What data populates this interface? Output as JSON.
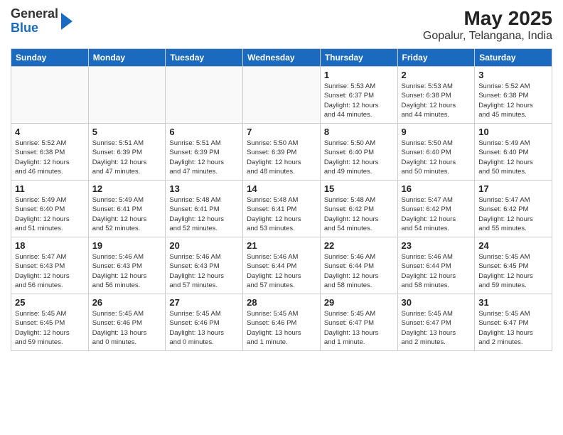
{
  "header": {
    "logo_general": "General",
    "logo_blue": "Blue",
    "title": "May 2025",
    "subtitle": "Gopalur, Telangana, India"
  },
  "days_of_week": [
    "Sunday",
    "Monday",
    "Tuesday",
    "Wednesday",
    "Thursday",
    "Friday",
    "Saturday"
  ],
  "weeks": [
    [
      {
        "day": "",
        "info": ""
      },
      {
        "day": "",
        "info": ""
      },
      {
        "day": "",
        "info": ""
      },
      {
        "day": "",
        "info": ""
      },
      {
        "day": "1",
        "info": "Sunrise: 5:53 AM\nSunset: 6:37 PM\nDaylight: 12 hours\nand 44 minutes."
      },
      {
        "day": "2",
        "info": "Sunrise: 5:53 AM\nSunset: 6:38 PM\nDaylight: 12 hours\nand 44 minutes."
      },
      {
        "day": "3",
        "info": "Sunrise: 5:52 AM\nSunset: 6:38 PM\nDaylight: 12 hours\nand 45 minutes."
      }
    ],
    [
      {
        "day": "4",
        "info": "Sunrise: 5:52 AM\nSunset: 6:38 PM\nDaylight: 12 hours\nand 46 minutes."
      },
      {
        "day": "5",
        "info": "Sunrise: 5:51 AM\nSunset: 6:39 PM\nDaylight: 12 hours\nand 47 minutes."
      },
      {
        "day": "6",
        "info": "Sunrise: 5:51 AM\nSunset: 6:39 PM\nDaylight: 12 hours\nand 47 minutes."
      },
      {
        "day": "7",
        "info": "Sunrise: 5:50 AM\nSunset: 6:39 PM\nDaylight: 12 hours\nand 48 minutes."
      },
      {
        "day": "8",
        "info": "Sunrise: 5:50 AM\nSunset: 6:40 PM\nDaylight: 12 hours\nand 49 minutes."
      },
      {
        "day": "9",
        "info": "Sunrise: 5:50 AM\nSunset: 6:40 PM\nDaylight: 12 hours\nand 50 minutes."
      },
      {
        "day": "10",
        "info": "Sunrise: 5:49 AM\nSunset: 6:40 PM\nDaylight: 12 hours\nand 50 minutes."
      }
    ],
    [
      {
        "day": "11",
        "info": "Sunrise: 5:49 AM\nSunset: 6:40 PM\nDaylight: 12 hours\nand 51 minutes."
      },
      {
        "day": "12",
        "info": "Sunrise: 5:49 AM\nSunset: 6:41 PM\nDaylight: 12 hours\nand 52 minutes."
      },
      {
        "day": "13",
        "info": "Sunrise: 5:48 AM\nSunset: 6:41 PM\nDaylight: 12 hours\nand 52 minutes."
      },
      {
        "day": "14",
        "info": "Sunrise: 5:48 AM\nSunset: 6:41 PM\nDaylight: 12 hours\nand 53 minutes."
      },
      {
        "day": "15",
        "info": "Sunrise: 5:48 AM\nSunset: 6:42 PM\nDaylight: 12 hours\nand 54 minutes."
      },
      {
        "day": "16",
        "info": "Sunrise: 5:47 AM\nSunset: 6:42 PM\nDaylight: 12 hours\nand 54 minutes."
      },
      {
        "day": "17",
        "info": "Sunrise: 5:47 AM\nSunset: 6:42 PM\nDaylight: 12 hours\nand 55 minutes."
      }
    ],
    [
      {
        "day": "18",
        "info": "Sunrise: 5:47 AM\nSunset: 6:43 PM\nDaylight: 12 hours\nand 56 minutes."
      },
      {
        "day": "19",
        "info": "Sunrise: 5:46 AM\nSunset: 6:43 PM\nDaylight: 12 hours\nand 56 minutes."
      },
      {
        "day": "20",
        "info": "Sunrise: 5:46 AM\nSunset: 6:43 PM\nDaylight: 12 hours\nand 57 minutes."
      },
      {
        "day": "21",
        "info": "Sunrise: 5:46 AM\nSunset: 6:44 PM\nDaylight: 12 hours\nand 57 minutes."
      },
      {
        "day": "22",
        "info": "Sunrise: 5:46 AM\nSunset: 6:44 PM\nDaylight: 12 hours\nand 58 minutes."
      },
      {
        "day": "23",
        "info": "Sunrise: 5:46 AM\nSunset: 6:44 PM\nDaylight: 12 hours\nand 58 minutes."
      },
      {
        "day": "24",
        "info": "Sunrise: 5:45 AM\nSunset: 6:45 PM\nDaylight: 12 hours\nand 59 minutes."
      }
    ],
    [
      {
        "day": "25",
        "info": "Sunrise: 5:45 AM\nSunset: 6:45 PM\nDaylight: 12 hours\nand 59 minutes."
      },
      {
        "day": "26",
        "info": "Sunrise: 5:45 AM\nSunset: 6:46 PM\nDaylight: 13 hours\nand 0 minutes."
      },
      {
        "day": "27",
        "info": "Sunrise: 5:45 AM\nSunset: 6:46 PM\nDaylight: 13 hours\nand 0 minutes."
      },
      {
        "day": "28",
        "info": "Sunrise: 5:45 AM\nSunset: 6:46 PM\nDaylight: 13 hours\nand 1 minute."
      },
      {
        "day": "29",
        "info": "Sunrise: 5:45 AM\nSunset: 6:47 PM\nDaylight: 13 hours\nand 1 minute."
      },
      {
        "day": "30",
        "info": "Sunrise: 5:45 AM\nSunset: 6:47 PM\nDaylight: 13 hours\nand 2 minutes."
      },
      {
        "day": "31",
        "info": "Sunrise: 5:45 AM\nSunset: 6:47 PM\nDaylight: 13 hours\nand 2 minutes."
      }
    ]
  ]
}
